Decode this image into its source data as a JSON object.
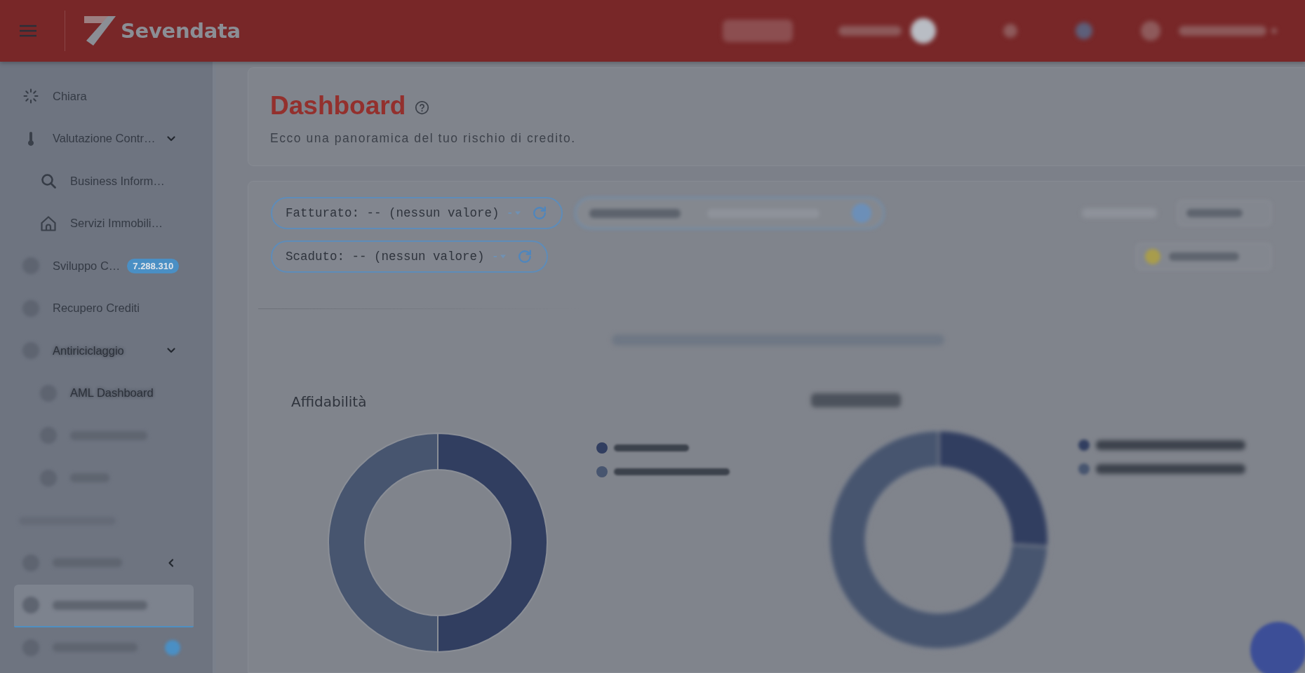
{
  "top_bar": {
    "logo_text": "Sevendata",
    "right_items": [
      {
        "kind": "pill"
      },
      {
        "kind": "label_knob"
      },
      {
        "kind": "icon"
      },
      {
        "kind": "icon_dot"
      },
      {
        "kind": "user"
      }
    ]
  },
  "sidebar": {
    "items": [
      {
        "kind": "link",
        "label": "Chiara",
        "selected": false
      },
      {
        "kind": "link",
        "label": "Valutazione Contr…",
        "selected": false,
        "expanded": true,
        "children": [
          {
            "kind": "link",
            "label": "Business Inform…",
            "selected": false
          },
          {
            "kind": "link",
            "label": "Servizi Immobili…",
            "selected": false
          }
        ]
      },
      {
        "kind": "link",
        "label": "Sviluppo C…",
        "badge": "7.288.310",
        "selected": false
      },
      {
        "kind": "link",
        "label": "Recupero Crediti",
        "selected": false
      },
      {
        "kind": "link",
        "label": "Antiriciclaggio",
        "blurred": true,
        "selected": false,
        "expanded": true,
        "children": [
          {
            "kind": "link",
            "label": "AML Dashboard",
            "blurred": true,
            "selected": false
          },
          {
            "kind": "link",
            "blurred": true,
            "selected": false
          },
          {
            "kind": "link",
            "blurred": true,
            "selected": false
          }
        ]
      },
      {
        "kind": "heading",
        "blurred": true
      },
      {
        "kind": "link",
        "blurred": true,
        "selected": false,
        "expanded": false
      },
      {
        "kind": "link",
        "blurred": true,
        "selected": true
      },
      {
        "kind": "link",
        "blurred": true,
        "selected": false,
        "counter_badge": true
      }
    ]
  },
  "header": {
    "title": "Dashboard",
    "subtitle": "Ecco una panoramica del tuo rischio di credito."
  },
  "filters": {
    "rows": [
      {
        "chips": [
          {
            "kind": "value",
            "label": "Fatturato: -- (nessun valore)"
          },
          {
            "kind": "blurred"
          }
        ],
        "actions": [
          {
            "kind": "blurred_text"
          },
          {
            "kind": "blurred_button"
          }
        ]
      },
      {
        "chips": [
          {
            "kind": "value",
            "label": "Scaduto: -- (nessun valore)"
          }
        ],
        "actions": [
          {
            "kind": "blurred_icon_button"
          }
        ]
      }
    ],
    "selection_note": {
      "blurred": true
    }
  },
  "charts": [
    {
      "title": "Affidabilità",
      "blurred": false,
      "chart_data": {
        "type": "donut",
        "values": [
          50,
          50
        ]
      },
      "legend": [
        {
          "color": "#313e60",
          "blurred": true
        },
        {
          "color": "#47556f",
          "blurred": true
        }
      ]
    },
    {
      "blurred": true,
      "chart_data": {
        "type": "donut",
        "values": [
          26,
          74
        ]
      },
      "legend": [
        {
          "color": "#313e60",
          "blurred": true
        },
        {
          "color": "#47556f",
          "blurred": true
        }
      ]
    }
  ],
  "floating_button": {
    "blurred": true
  }
}
